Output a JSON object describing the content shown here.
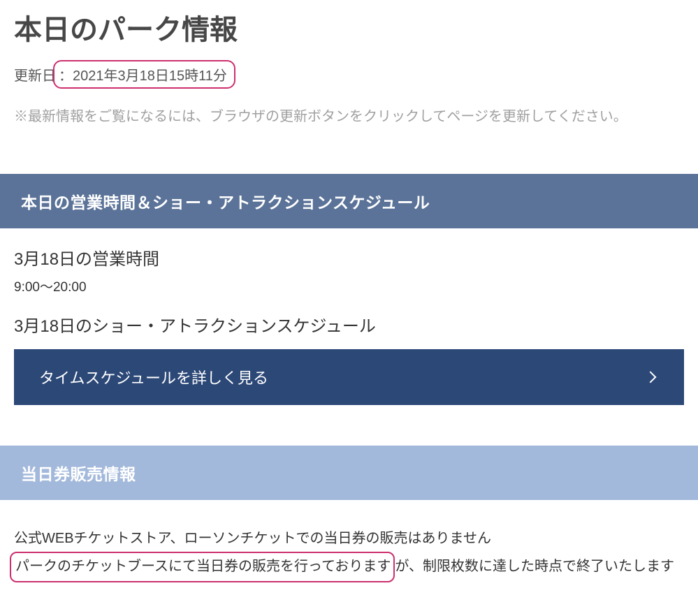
{
  "page": {
    "title": "本日のパーク情報",
    "update_label": "更新日",
    "update_separators": {
      "colon": "："
    },
    "updated_at": "2021年3月18日15時11分",
    "refresh_note": "※最新情報をご覧になるには、ブラウザの更新ボタンをクリックしてページを更新してください。"
  },
  "operating": {
    "header": "本日の営業時間＆ショー・アトラクションスケジュール",
    "hours_title": "3月18日の営業時間",
    "hours_value": "9:00～20:00",
    "schedule_title": "3月18日のショー・アトラクションスケジュール",
    "schedule_cta": "タイムスケジュールを詳しく見る"
  },
  "ticket": {
    "header": "当日券販売情報",
    "line1": "公式WEBチケットストア、ローソンチケットでの当日券の販売はありません",
    "line2_highlight": "パークのチケットブースにて当日券の販売を行っております",
    "line2_suffix": "が、制限枚数に達した時点で終了いたします"
  }
}
